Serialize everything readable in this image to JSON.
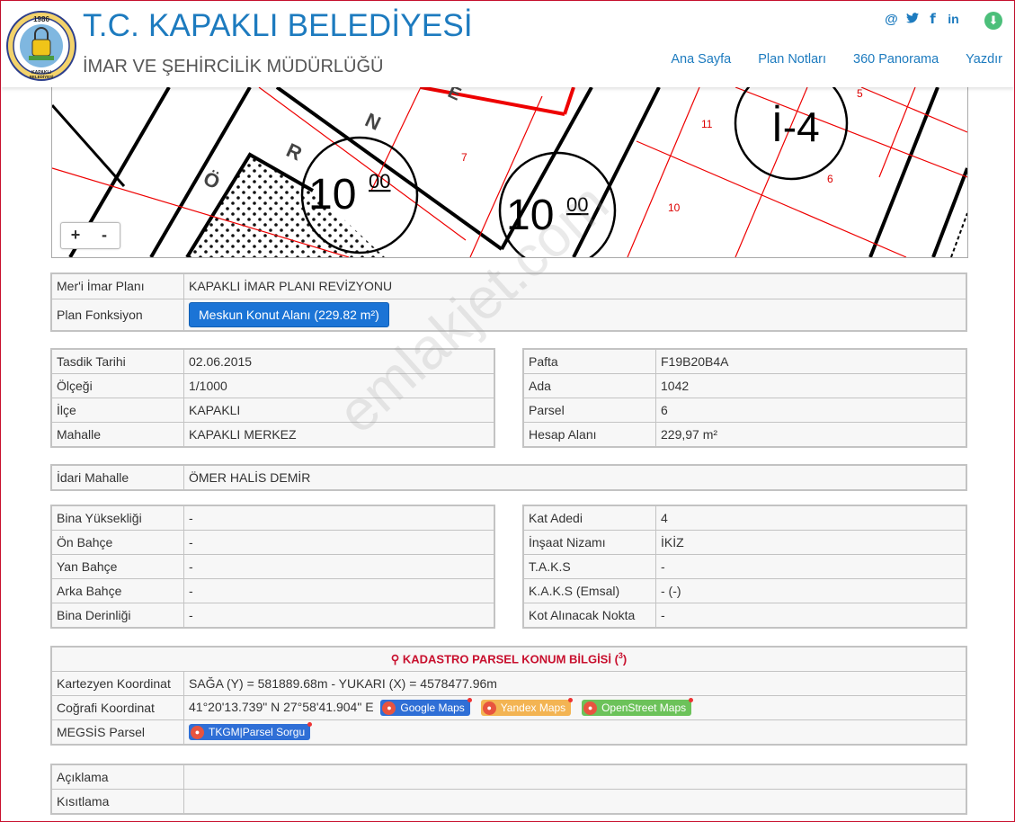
{
  "header": {
    "title": "T.C. KAPAKLI BELEDİYESİ",
    "subtitle": "İMAR VE ŞEHİRCİLİK MÜDÜRLÜĞÜ",
    "logo_year": "1986",
    "logo_text": "KAPAKLI BELEDİYESİ",
    "social": [
      "@",
      "twitter-icon",
      "facebook-icon",
      "linkedin-icon"
    ],
    "nav": [
      "Ana Sayfa",
      "Plan Notları",
      "360 Panorama",
      "Yazdır"
    ]
  },
  "map": {
    "labels": [
      "10",
      "00",
      "10",
      "00",
      "İ-4",
      "7",
      "10",
      "11",
      "5",
      "6",
      "N",
      "R",
      "E",
      "Ö"
    ],
    "zoom_in": "+",
    "zoom_out": "-"
  },
  "plan": {
    "meri_label": "Mer'i İmar Planı",
    "meri_value": "KAPAKLI İMAR PLANI REVİZYONU",
    "fonksiyon_label": "Plan Fonksiyon",
    "fonksiyon_value": "Meskun Konut Alanı (229.82 m²)"
  },
  "left_info": [
    {
      "label": "Tasdik Tarihi",
      "value": "02.06.2015"
    },
    {
      "label": "Ölçeği",
      "value": "1/1000"
    },
    {
      "label": "İlçe",
      "value": "KAPAKLI"
    },
    {
      "label": "Mahalle",
      "value": "KAPAKLI MERKEZ"
    }
  ],
  "right_info": [
    {
      "label": "Pafta",
      "value": "F19B20B4A"
    },
    {
      "label": "Ada",
      "value": "1042"
    },
    {
      "label": "Parsel",
      "value": "6"
    },
    {
      "label": "Hesap Alanı",
      "value": "229,97 m²"
    }
  ],
  "idari": {
    "label": "İdari Mahalle",
    "value": "ÖMER HALİS DEMİR"
  },
  "left_build": [
    {
      "label": "Bina Yüksekliği",
      "value": "-"
    },
    {
      "label": "Ön Bahçe",
      "value": "-"
    },
    {
      "label": "Yan Bahçe",
      "value": "-"
    },
    {
      "label": "Arka Bahçe",
      "value": "-"
    },
    {
      "label": "Bina Derinliği",
      "value": "-"
    }
  ],
  "right_build": [
    {
      "label": "Kat Adedi",
      "value": "4"
    },
    {
      "label": "İnşaat Nizamı",
      "value": "İKİZ"
    },
    {
      "label": "T.A.K.S",
      "value": "-"
    },
    {
      "label": "K.A.K.S (Emsal)",
      "value": "- (-)"
    },
    {
      "label": "Kot Alınacak Nokta",
      "value": "-"
    }
  ],
  "kadastro": {
    "title": "KADASTRO PARSEL KONUM BİLGİSİ (",
    "title_sup": "3",
    "title_end": ")",
    "kartezyen_label": "Kartezyen Koordinat",
    "kartezyen_value": "SAĞA (Y) = 581889.68m - YUKARI (X) = 4578477.96m",
    "cografi_label": "Coğrafi Koordinat",
    "cografi_value": "41°20'13.739\" N 27°58'41.904\" E",
    "google": "Google Maps",
    "yandex": "Yandex Maps",
    "osm": "OpenStreet Maps",
    "megsis_label": "MEGSİS Parsel",
    "tkgm": "TKGM|Parsel Sorgu",
    "colors": {
      "google": "#2f6fd6",
      "yandex": "#f3b453",
      "osm": "#6cc25a",
      "tkgm": "#2f6fd6"
    }
  },
  "notes": [
    {
      "label": "Açıklama",
      "value": ""
    },
    {
      "label": "Kısıtlama",
      "value": ""
    }
  ],
  "watermark": "emlakjet.com"
}
